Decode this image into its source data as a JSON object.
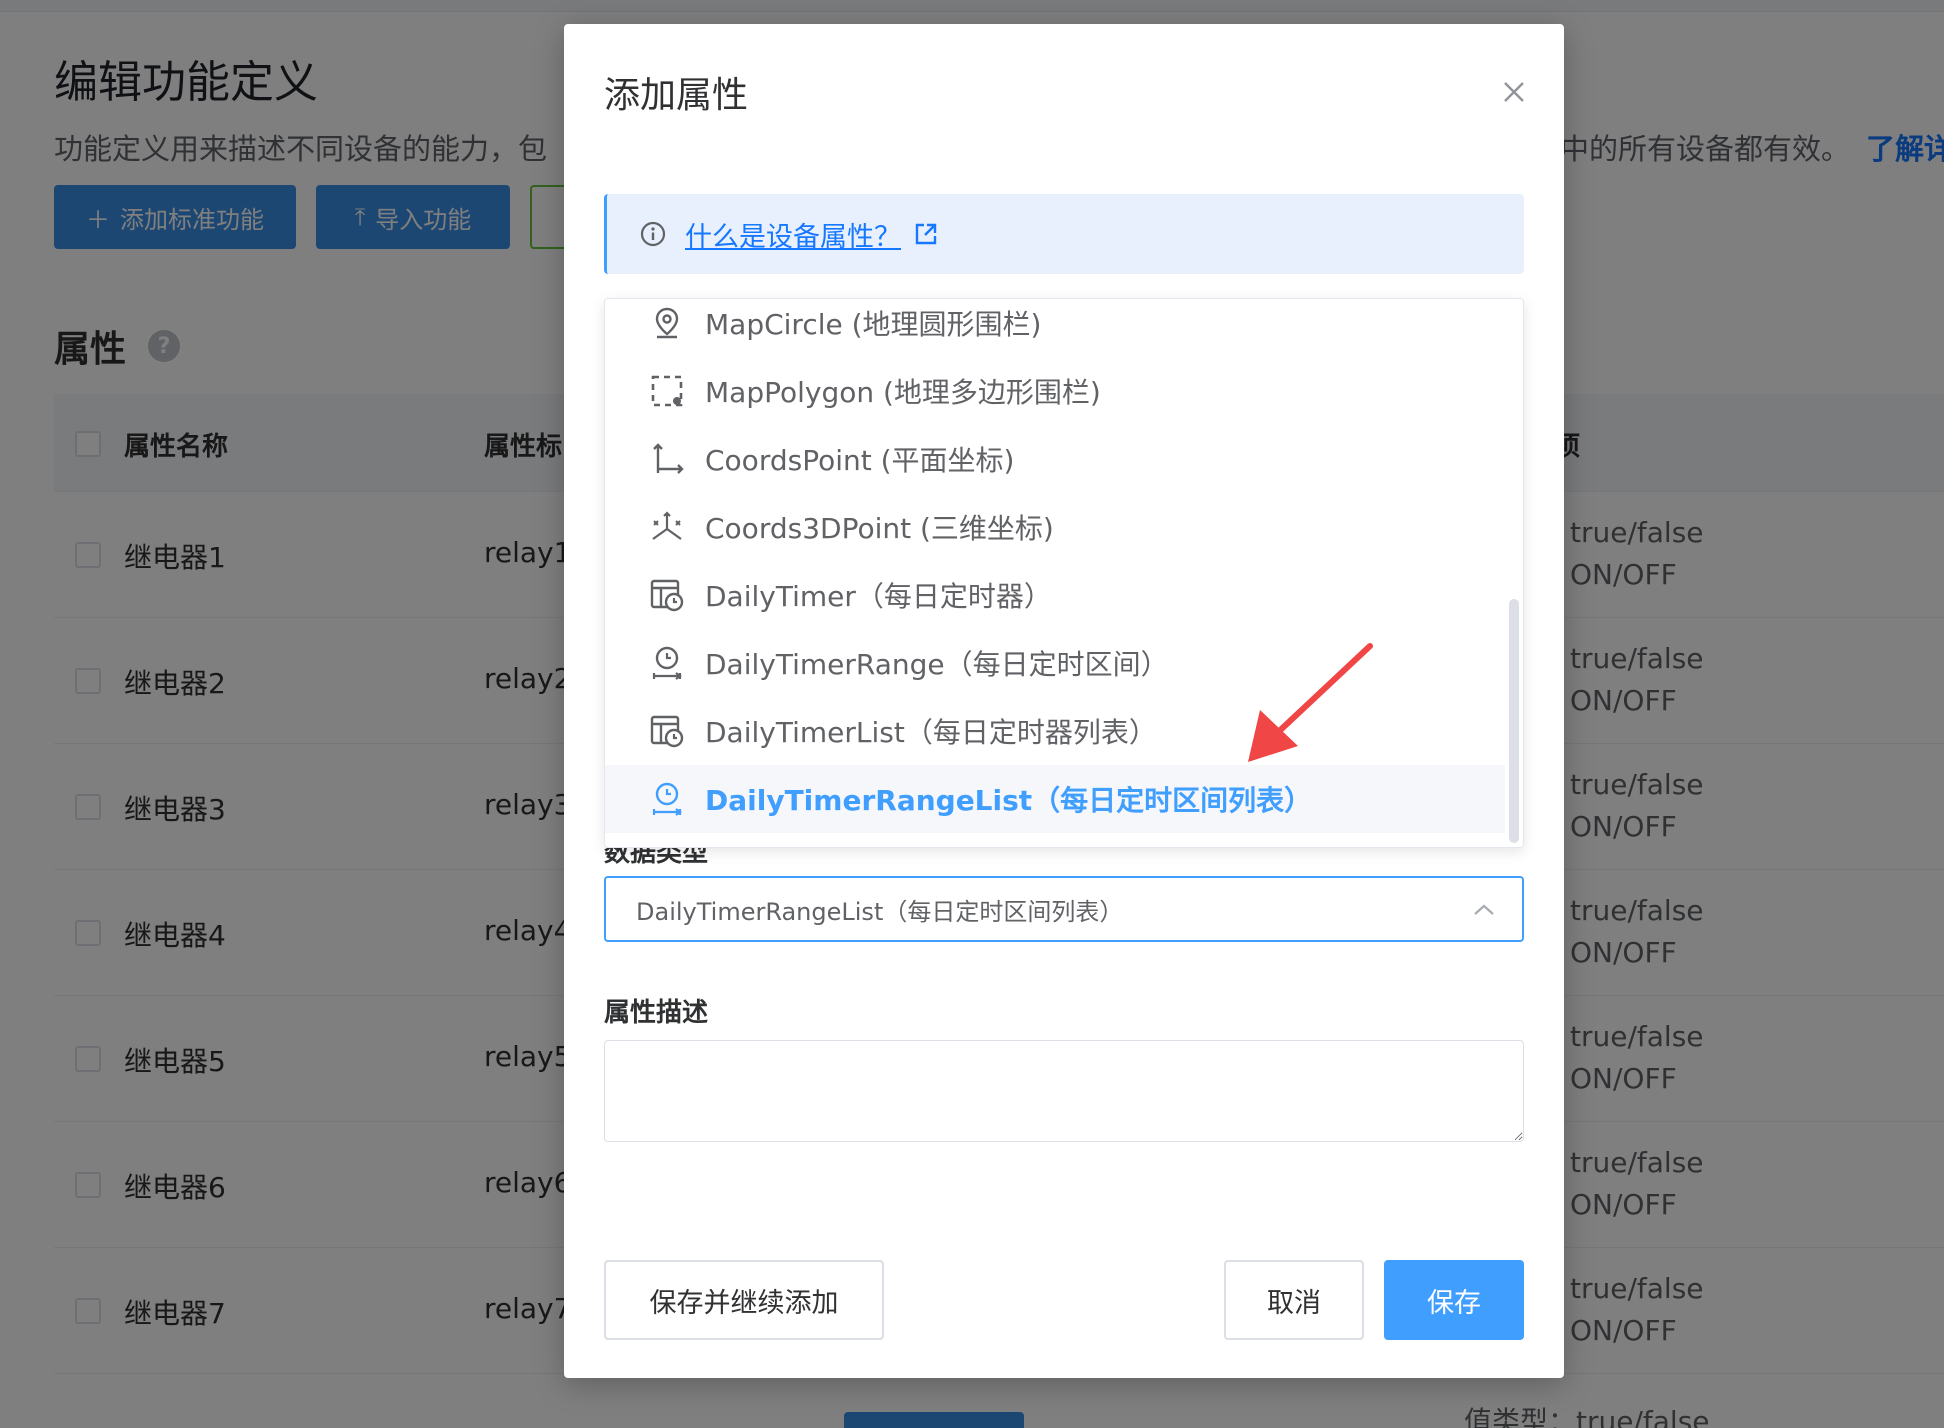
{
  "page": {
    "title": "编辑功能定义",
    "description": "功能定义用来描述不同设备的能力，包",
    "description_tail": "中的所有设备都有效。",
    "learn_more": "了解详",
    "buttons": {
      "add_standard": "添加标准功能",
      "import": "导入功能"
    },
    "section_title": "属性",
    "section_help": "?",
    "table": {
      "headers": [
        "属性名称",
        "属性标",
        "项"
      ],
      "rows": [
        {
          "name": "继电器1",
          "identifier": "relay1",
          "value1": "true/false",
          "value2": "ON/OFF"
        },
        {
          "name": "继电器2",
          "identifier": "relay2",
          "value1": "true/false",
          "value2": "ON/OFF"
        },
        {
          "name": "继电器3",
          "identifier": "relay3",
          "value1": "true/false",
          "value2": "ON/OFF"
        },
        {
          "name": "继电器4",
          "identifier": "relay4",
          "value1": "true/false",
          "value2": "ON/OFF"
        },
        {
          "name": "继电器5",
          "identifier": "relay5",
          "value1": "true/false",
          "value2": "ON/OFF"
        },
        {
          "name": "继电器6",
          "identifier": "relay6",
          "value1": "true/false",
          "value2": "ON/OFF"
        },
        {
          "name": "继电器7",
          "identifier": "relay7",
          "value1": "true/false",
          "value2": "ON/OFF"
        }
      ],
      "last_row_value": "值类型：true/false"
    }
  },
  "dialog": {
    "title": "添加属性",
    "info_link": "什么是设备属性？",
    "dropdown_items": [
      {
        "label": "MapCircle (地理圆形围栏)",
        "icon": "map-pin-icon"
      },
      {
        "label": "MapPolygon (地理多边形围栏)",
        "icon": "polygon-icon"
      },
      {
        "label": "CoordsPoint (平面坐标)",
        "icon": "axes-2d-icon"
      },
      {
        "label": "Coords3DPoint (三维坐标)",
        "icon": "axes-3d-icon"
      },
      {
        "label": "DailyTimer（每日定时器）",
        "icon": "calendar-clock-icon"
      },
      {
        "label": "DailyTimerRange（每日定时区间）",
        "icon": "clock-range-icon"
      },
      {
        "label": "DailyTimerList（每日定时器列表）",
        "icon": "calendar-clock-icon"
      },
      {
        "label": "DailyTimerRangeList（每日定时区间列表）",
        "icon": "clock-range-icon",
        "selected": true
      }
    ],
    "data_type_label": "数据类型",
    "data_type_value": "DailyTimerRangeList（每日定时区间列表）",
    "description_label": "属性描述",
    "description_value": "",
    "buttons": {
      "save_continue": "保存并继续添加",
      "cancel": "取消",
      "save": "保存"
    }
  },
  "colors": {
    "primary": "#409eff",
    "overlay": "rgba(0,0,0,0.5)",
    "annotation_arrow": "#f04646"
  }
}
